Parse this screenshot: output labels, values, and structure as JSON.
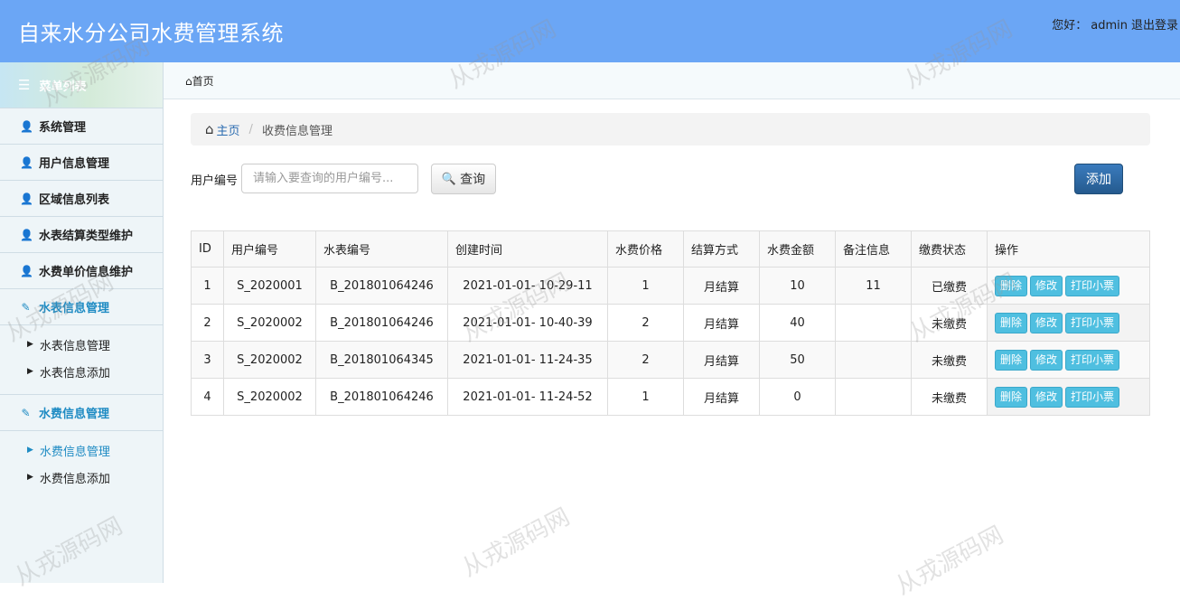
{
  "header": {
    "title": "自来水分公司水费管理系统",
    "greeting": "您好：",
    "username": "admin",
    "logout": "退出登录"
  },
  "sidebar": {
    "head_label": "菜单列表",
    "items": [
      {
        "label": "系统管理"
      },
      {
        "label": "用户信息管理"
      },
      {
        "label": "区域信息列表"
      },
      {
        "label": "水表结算类型维护"
      },
      {
        "label": "水费单价信息维护"
      },
      {
        "label": "水表信息管理"
      },
      {
        "label": "水费信息管理"
      }
    ],
    "meter_sub": [
      {
        "label": "水表信息管理"
      },
      {
        "label": "水表信息添加"
      }
    ],
    "fee_sub": [
      {
        "label": "水费信息管理"
      },
      {
        "label": "水费信息添加"
      }
    ]
  },
  "tabs": {
    "home": "首页"
  },
  "breadcrumb": {
    "home": "主页",
    "current": "收费信息管理"
  },
  "search": {
    "label": "用户编号",
    "placeholder": "请输入要查询的用户编号...",
    "button": "查询"
  },
  "add_button": "添加",
  "table": {
    "headers": [
      "ID",
      "用户编号",
      "水表编号",
      "创建时间",
      "水费价格",
      "结算方式",
      "水费金额",
      "备注信息",
      "缴费状态",
      "操作"
    ],
    "rows": [
      [
        "1",
        "S_2020001",
        "B_201801064246",
        "2021-01-01- 10-29-11",
        "1",
        "月结算",
        "10",
        "11",
        "已缴费"
      ],
      [
        "2",
        "S_2020002",
        "B_201801064246",
        "2021-01-01- 10-40-39",
        "2",
        "月结算",
        "40",
        "",
        "未缴费"
      ],
      [
        "3",
        "S_2020002",
        "B_201801064345",
        "2021-01-01- 11-24-35",
        "2",
        "月结算",
        "50",
        "",
        "未缴费"
      ],
      [
        "4",
        "S_2020002",
        "B_201801064246",
        "2021-01-01- 11-24-52",
        "1",
        "月结算",
        "0",
        "",
        "未缴费"
      ]
    ],
    "actions": [
      "删除",
      "修改",
      "打印小票"
    ]
  },
  "watermark": "从戎源码网",
  "icons": {
    "menu": "list-icon",
    "user": "user-icon",
    "edit": "edit-icon",
    "home": "home-icon",
    "search": "search-icon"
  },
  "colors": {
    "header_bg": "#6ba6f5",
    "accent": "#1e8bc3",
    "add_button": "#255a8e",
    "action_button": "#4fbfe0"
  }
}
